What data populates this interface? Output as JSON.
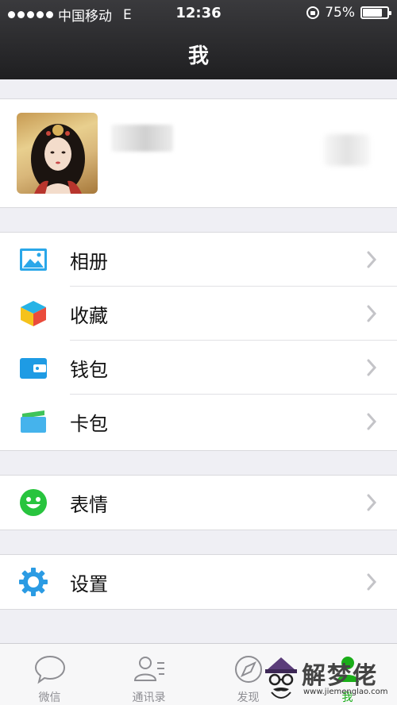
{
  "status_bar": {
    "carrier": "中国移动",
    "network": "E",
    "time": "12:36",
    "battery": "75%",
    "battery_level": 0.75
  },
  "nav": {
    "title": "我"
  },
  "menu": {
    "group1": [
      {
        "label": "相册",
        "icon": "album-icon"
      },
      {
        "label": "收藏",
        "icon": "favorites-icon"
      },
      {
        "label": "钱包",
        "icon": "wallet-icon"
      },
      {
        "label": "卡包",
        "icon": "card-pack-icon"
      }
    ],
    "group2": [
      {
        "label": "表情",
        "icon": "sticker-icon"
      }
    ],
    "group3": [
      {
        "label": "设置",
        "icon": "gear-icon"
      }
    ]
  },
  "tabs": [
    {
      "label": "微信",
      "icon": "chat-bubble-icon",
      "active": false
    },
    {
      "label": "通讯录",
      "icon": "contacts-icon",
      "active": false
    },
    {
      "label": "发现",
      "icon": "compass-icon",
      "active": false
    },
    {
      "label": "我",
      "icon": "me-icon",
      "active": true
    }
  ],
  "watermark": {
    "text": "解梦佬",
    "url": "www.jiemenglao.com"
  },
  "colors": {
    "accent_green": "#1aad19",
    "album_blue": "#2aa7e9",
    "wallet_blue": "#1e9be4",
    "sticker_green": "#28c43e",
    "gear_blue": "#2b9be3"
  }
}
